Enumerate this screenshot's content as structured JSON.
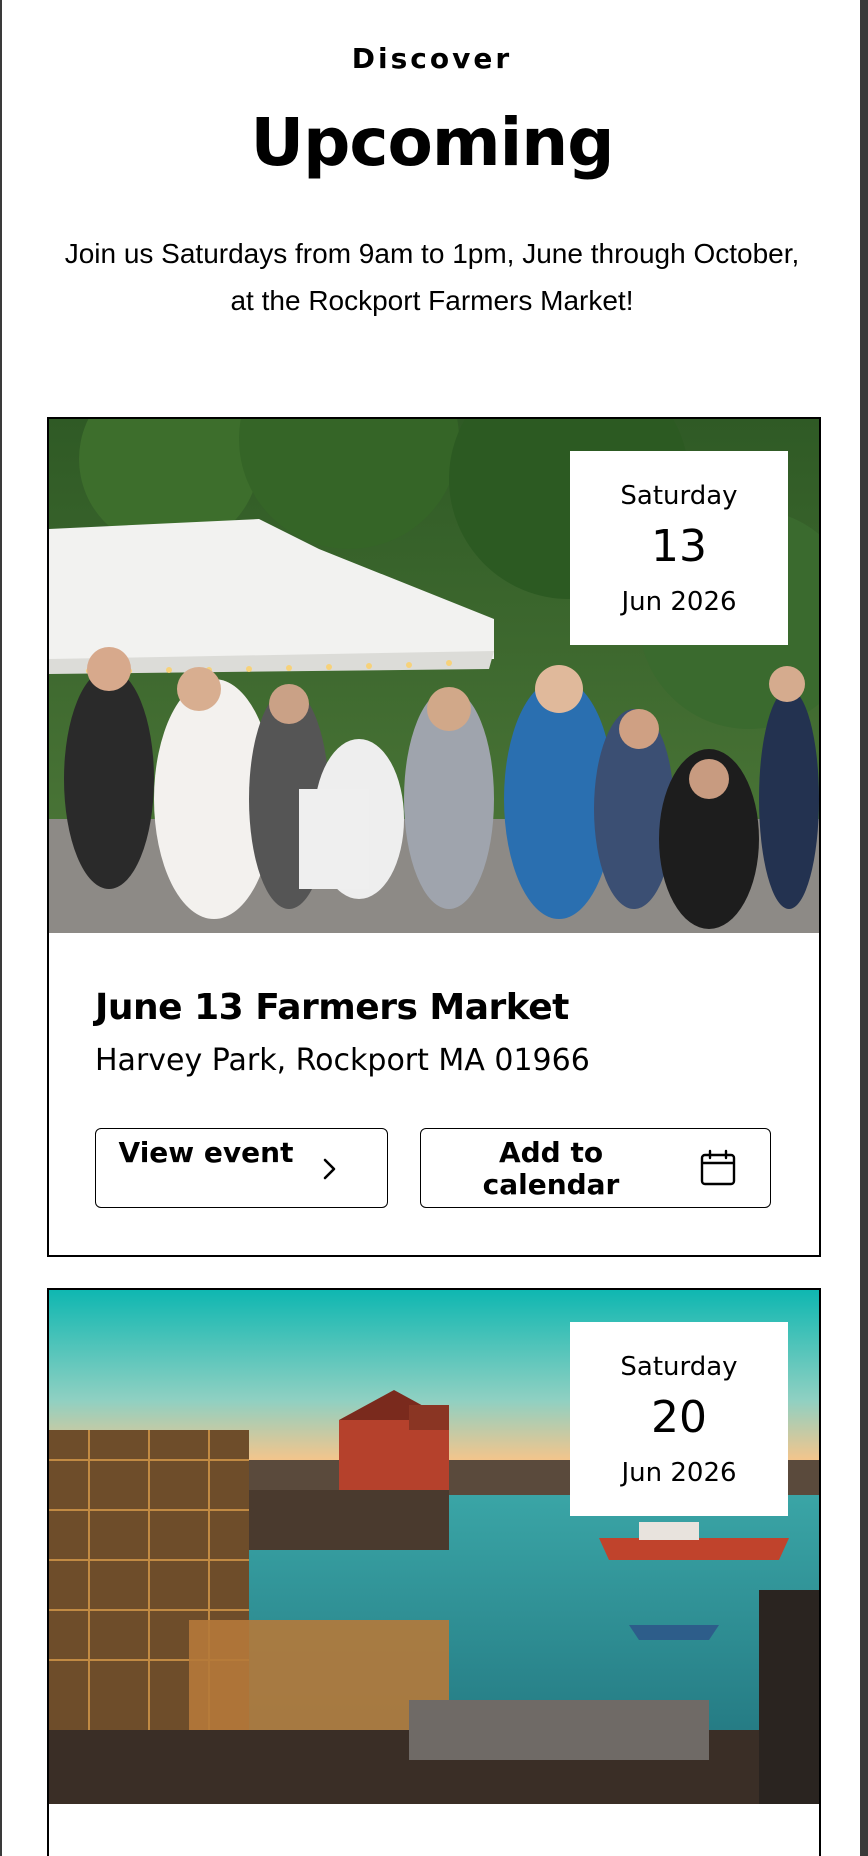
{
  "section": {
    "eyebrow": "Discover",
    "heading": "Upcoming",
    "intro": "Join us Saturdays from 9am to 1pm, June through October, at the Rockport Farmers Market!"
  },
  "events": [
    {
      "weekday": "Saturday",
      "day": "13",
      "month_year": "Jun 2026",
      "title": "June 13 Farmers Market",
      "location": "Harvey Park, Rockport MA 01966",
      "view_label": "View event",
      "calendar_label": "Add to calendar",
      "image": "market-crowd-photo"
    },
    {
      "weekday": "Saturday",
      "day": "20",
      "month_year": "Jun 2026",
      "image": "harbor-lobster-traps-photo"
    }
  ],
  "icons": {
    "view": "chevron-right-icon",
    "calendar": "calendar-icon"
  },
  "colors": {
    "text": "#000000",
    "border": "#000000",
    "background": "#ffffff",
    "frame": "#3a3a3a"
  }
}
